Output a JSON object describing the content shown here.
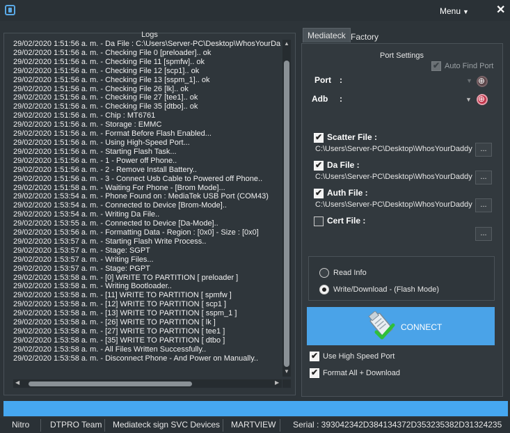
{
  "titlebar": {
    "menu_label": "Menu",
    "icons": [
      "app-icon",
      "close-icon"
    ]
  },
  "logs": {
    "title": "Logs",
    "lines": [
      "29/02/2020 1:51:56 a. m. - Da File : C:\\Users\\Server-PC\\Desktop\\WhosYourDa",
      "29/02/2020 1:51:56 a. m. - Checking File 0 [preloader].. ok",
      "29/02/2020 1:51:56 a. m. - Checking File 11 [spmfw].. ok",
      "29/02/2020 1:51:56 a. m. - Checking File 12 [scp1].. ok",
      "29/02/2020 1:51:56 a. m. - Checking File 13 [sspm_1].. ok",
      "29/02/2020 1:51:56 a. m. - Checking File 26 [lk].. ok",
      "29/02/2020 1:51:56 a. m. - Checking File 27 [tee1].. ok",
      "29/02/2020 1:51:56 a. m. - Checking File 35 [dtbo].. ok",
      "29/02/2020 1:51:56 a. m. - Chip : MT6761",
      "29/02/2020 1:51:56 a. m. - Storage : EMMC",
      "29/02/2020 1:51:56 a. m. - Format Before Flash Enabled...",
      "29/02/2020 1:51:56 a. m. - Using High-Speed Port...",
      "29/02/2020 1:51:56 a. m. - Starting Flash Task...",
      "29/02/2020 1:51:56 a. m. - 1 - Power off Phone..",
      "29/02/2020 1:51:56 a. m. - 2 - Remove Install Battery..",
      "29/02/2020 1:51:56 a. m. - 3 - Connect Usb Cable to Powered off Phone..",
      "29/02/2020 1:51:58 a. m. - Waiting For Phone - [Brom Mode]...",
      "29/02/2020 1:53:54 a. m. - Phone Found on : MediaTek USB Port (COM43)",
      "29/02/2020 1:53:54 a. m. - Connected to Device [Brom-Mode]..",
      "29/02/2020 1:53:54 a. m. - Writing Da File..",
      "29/02/2020 1:53:55 a. m. - Connected to Device [Da-Mode]..",
      "29/02/2020 1:53:56 a. m. - Formatting Data - Region : [0x0] - Size : [0x0]",
      "29/02/2020 1:53:57 a. m. - Starting Flash Write Process..",
      "29/02/2020 1:53:57 a. m. - Stage: SGPT",
      "29/02/2020 1:53:57 a. m. - Writing Files...",
      "29/02/2020 1:53:57 a. m. - Stage: PGPT",
      "29/02/2020 1:53:58 a. m. - [0] WRITE TO PARTITION [ preloader ]",
      "29/02/2020 1:53:58 a. m. - Writing Bootloader..",
      "29/02/2020 1:53:58 a. m. - [11] WRITE TO PARTITION [ spmfw ]",
      "29/02/2020 1:53:58 a. m. - [12] WRITE TO PARTITION [ scp1 ]",
      "29/02/2020 1:53:58 a. m. - [13] WRITE TO PARTITION [ sspm_1 ]",
      "29/02/2020 1:53:58 a. m. - [26] WRITE TO PARTITION [ lk ]",
      "29/02/2020 1:53:58 a. m. - [27] WRITE TO PARTITION [ tee1 ]",
      "29/02/2020 1:53:58 a. m. - [35] WRITE TO PARTITION [ dtbo ]",
      "29/02/2020 1:53:58 a. m. - All Files Written Successfully..",
      "29/02/2020 1:53:58 a. m. - Disconnect Phone - And Power on Manually.."
    ]
  },
  "tabs": [
    {
      "label": "Mediateck",
      "active": true
    },
    {
      "label": "Factory",
      "active": false
    }
  ],
  "port_settings": {
    "title": "Port Settings",
    "auto_find_label": "Auto Find Port",
    "auto_find_checked": true,
    "port_label": "Port",
    "adb_label": "Adb",
    "colon": ":"
  },
  "files": {
    "scatter": {
      "label": "Scatter File :",
      "checked": true,
      "path": "C:\\Users\\Server-PC\\Desktop\\WhosYourDaddy"
    },
    "da": {
      "label": "Da File :",
      "checked": true,
      "path": "C:\\Users\\Server-PC\\Desktop\\WhosYourDaddy"
    },
    "auth": {
      "label": "Auth File :",
      "checked": true,
      "path": "C:\\Users\\Server-PC\\Desktop\\WhosYourDaddy"
    },
    "cert": {
      "label": "Cert File :",
      "checked": false,
      "path": ""
    },
    "browse_label": "..."
  },
  "mode": {
    "read_info_label": "Read Info",
    "write_label": "Write/Download - (Flash Mode)",
    "selected": "write"
  },
  "connect": {
    "label": "CONNECT",
    "icon": "usb-connect-icon"
  },
  "options": {
    "high_speed_label": "Use High Speed Port",
    "high_speed_checked": true,
    "format_label": "Format All + Download",
    "format_checked": true
  },
  "statusbar": {
    "items": [
      "Nitro",
      "DTPRO Team",
      "Mediateck sign SVC Devices",
      "MARTVIEW",
      "Serial : 393042342D384134372D353235382D31324235"
    ]
  },
  "colors": {
    "accent": "#46a7f0",
    "background": "#2d3439",
    "refresh": "#c0344a"
  }
}
